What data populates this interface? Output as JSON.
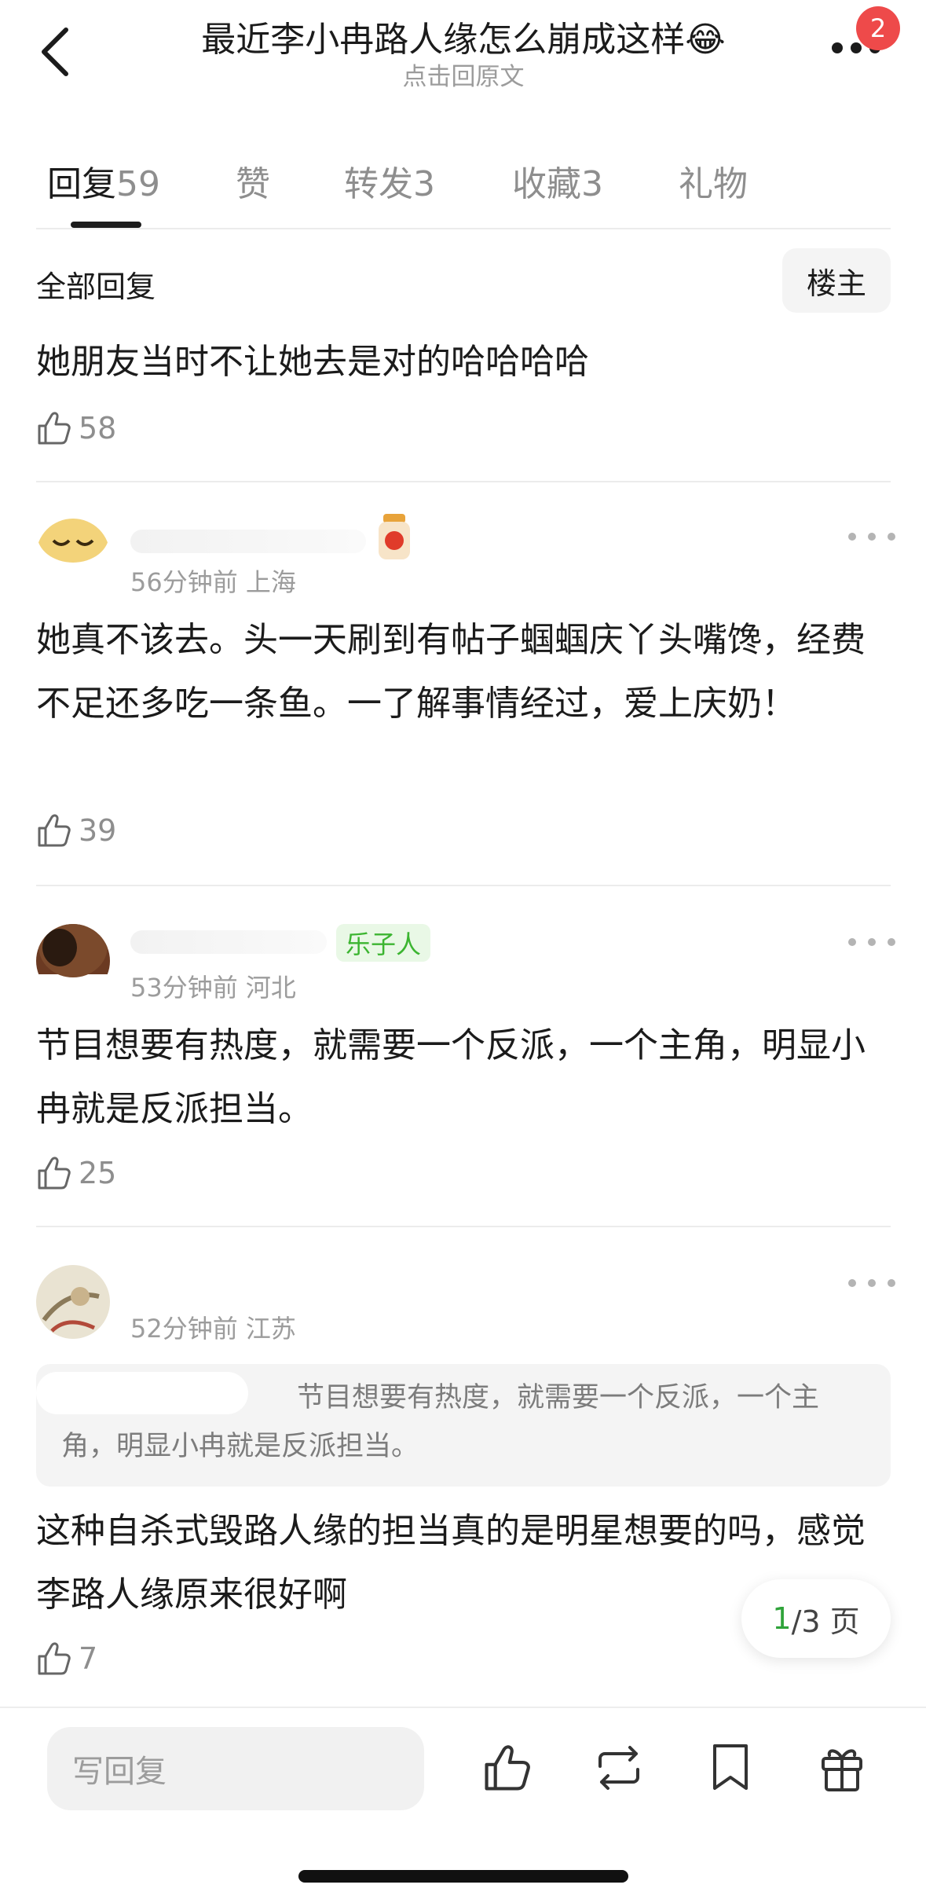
{
  "header": {
    "title": "最近李小冉路人缘怎么崩成这样😂",
    "subtitle": "点击回原文",
    "badge_count": "2"
  },
  "tabs": [
    {
      "label": "回复",
      "count": "59",
      "active": true
    },
    {
      "label": "赞",
      "count": ""
    },
    {
      "label": "转发",
      "count": "3"
    },
    {
      "label": "收藏",
      "count": "3"
    },
    {
      "label": "礼物",
      "count": ""
    }
  ],
  "section": {
    "title": "全部回复",
    "op_filter": "楼主"
  },
  "comments": [
    {
      "text": "她朋友当时不让她去是对的哈哈哈哈",
      "likes": "58"
    },
    {
      "meta": "56分钟前 上海",
      "text": "她真不该去。头一天刷到有帖子蝈蝈庆丫头嘴馋，经费不足还多吃一条鱼。一了解事情经过，爱上庆奶！",
      "likes": "39"
    },
    {
      "tag": "乐子人",
      "meta": "53分钟前 河北",
      "text": "节目想要有热度，就需要一个反派，一个主角，明显小冉就是反派担当。",
      "likes": "25"
    },
    {
      "meta": "52分钟前 江苏",
      "quote": "节目想要有热度，就需要一个反派，一个主角，明显小冉就是反派担当。",
      "text": "这种自杀式毁路人缘的担当真的是明星想要的吗，感觉李路人缘原来很好啊",
      "likes": "7"
    }
  ],
  "pagination": {
    "current": "1",
    "rest": "/3 页"
  },
  "bottombar": {
    "reply_placeholder": "写回复",
    "icons": [
      "like-icon",
      "repost-icon",
      "bookmark-icon",
      "gift-icon"
    ]
  }
}
